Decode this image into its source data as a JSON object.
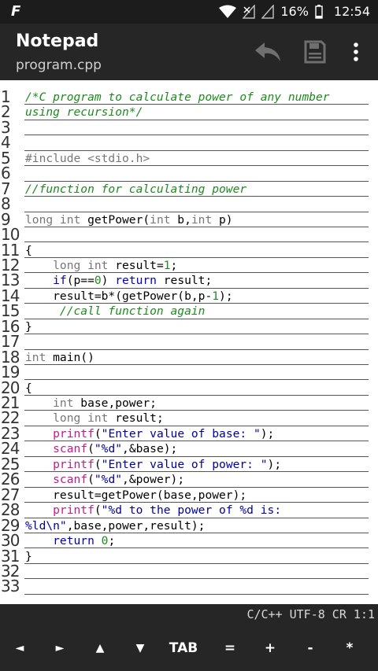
{
  "status_bar": {
    "left_glyph": "F",
    "battery": "16%",
    "time": "12:54"
  },
  "app_bar": {
    "title": "Notepad",
    "subtitle": "program.cpp",
    "icons": [
      "undo-icon",
      "save-icon",
      "overflow-menu-icon"
    ]
  },
  "editor": {
    "line_numbers": [
      "1",
      "2",
      "3",
      "4",
      "5",
      "6",
      "7",
      "8",
      "9",
      "10",
      "11",
      "12",
      "13",
      "14",
      "15",
      "16",
      "17",
      "18",
      "19",
      "20",
      "21",
      "22",
      "23",
      "24",
      "25",
      "26",
      "27",
      "28",
      "29",
      "30",
      "31",
      "32",
      "33"
    ],
    "lines": [
      [
        {
          "c": "cmt",
          "t": "/*C program to calculate power of any number"
        }
      ],
      [
        {
          "c": "cmt",
          "t": "using recursion*/"
        }
      ],
      [],
      [],
      [
        {
          "c": "pre",
          "t": "#include <stdio.h>"
        }
      ],
      [],
      [
        {
          "c": "cmt",
          "t": "//function for calculating power"
        }
      ],
      [],
      [
        {
          "c": "kw",
          "t": "long int "
        },
        {
          "c": "",
          "t": "getPower("
        },
        {
          "c": "kw",
          "t": "int"
        },
        {
          "c": "",
          "t": " b,"
        },
        {
          "c": "kw",
          "t": "int"
        },
        {
          "c": "",
          "t": " p)"
        }
      ],
      [],
      [
        {
          "c": "",
          "t": "{"
        }
      ],
      [
        {
          "c": "kw",
          "t": "    long int "
        },
        {
          "c": "",
          "t": "result="
        },
        {
          "c": "num",
          "t": "1"
        },
        {
          "c": "",
          "t": ";"
        }
      ],
      [
        {
          "c": "kw2",
          "t": "    if"
        },
        {
          "c": "",
          "t": "(p=="
        },
        {
          "c": "num",
          "t": "0"
        },
        {
          "c": "",
          "t": ") "
        },
        {
          "c": "kw2",
          "t": "return"
        },
        {
          "c": "",
          "t": " result;"
        }
      ],
      [
        {
          "c": "",
          "t": "    result=b*(getPower(b,p-"
        },
        {
          "c": "num",
          "t": "1"
        },
        {
          "c": "",
          "t": ");"
        }
      ],
      [
        {
          "c": "cmt",
          "t": "     //call function again"
        }
      ],
      [
        {
          "c": "",
          "t": "}"
        }
      ],
      [],
      [
        {
          "c": "kw",
          "t": "int"
        },
        {
          "c": "",
          "t": " main()"
        }
      ],
      [],
      [
        {
          "c": "",
          "t": "{"
        }
      ],
      [
        {
          "c": "kw",
          "t": "    int"
        },
        {
          "c": "",
          "t": " base,power;"
        }
      ],
      [
        {
          "c": "kw",
          "t": "    long int "
        },
        {
          "c": "",
          "t": "result;"
        }
      ],
      [
        {
          "c": "fn",
          "t": "    printf"
        },
        {
          "c": "",
          "t": "("
        },
        {
          "c": "str",
          "t": "\"Enter value of base: \""
        },
        {
          "c": "",
          "t": ");"
        }
      ],
      [
        {
          "c": "fn",
          "t": "    scanf"
        },
        {
          "c": "",
          "t": "("
        },
        {
          "c": "str",
          "t": "\"%d\""
        },
        {
          "c": "",
          "t": ",&base);"
        }
      ],
      [
        {
          "c": "fn",
          "t": "    printf"
        },
        {
          "c": "",
          "t": "("
        },
        {
          "c": "str",
          "t": "\"Enter value of power: \""
        },
        {
          "c": "",
          "t": ");"
        }
      ],
      [
        {
          "c": "fn",
          "t": "    scanf"
        },
        {
          "c": "",
          "t": "("
        },
        {
          "c": "str",
          "t": "\"%d\""
        },
        {
          "c": "",
          "t": ",&power);"
        }
      ],
      [
        {
          "c": "",
          "t": "    result=getPower(base,power);"
        }
      ],
      [
        {
          "c": "fn",
          "t": "    printf"
        },
        {
          "c": "",
          "t": "("
        },
        {
          "c": "str",
          "t": "\"%d to the power of %d is:"
        }
      ],
      [
        {
          "c": "str",
          "t": "%ld\\n\""
        },
        {
          "c": "",
          "t": ",base,power,result);"
        }
      ],
      [
        {
          "c": "kw2",
          "t": "    return"
        },
        {
          "c": "",
          "t": " "
        },
        {
          "c": "num",
          "t": "0"
        },
        {
          "c": "",
          "t": ";"
        }
      ],
      [
        {
          "c": "",
          "t": "}"
        }
      ],
      [],
      []
    ]
  },
  "status_line": "C/C++ UTF-8 CR 1:1",
  "key_bar": {
    "keys": [
      "◄",
      "►",
      "▲",
      "▼",
      "TAB",
      "=",
      "+",
      "-",
      "*"
    ]
  }
}
